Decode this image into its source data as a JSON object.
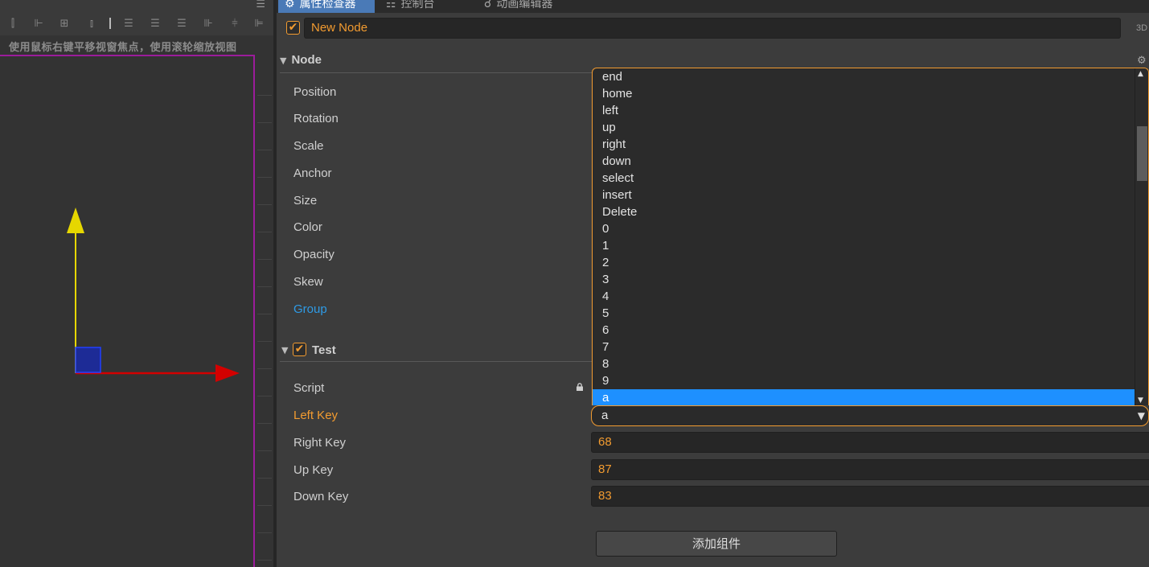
{
  "scene": {
    "hint": "使用鼠标右键平移视窗焦点，使用滚轮缩放视图",
    "toolbar_icons": [
      "align-left-icon",
      "align-hcenter-icon",
      "align-right-icon",
      "align-top-icon",
      "align-vcenter-icon",
      "align-bottom-icon",
      "distribute-h-icon",
      "distribute-v-icon",
      "distribute-center-icon"
    ],
    "menu_icon": "☰"
  },
  "tabs": [
    {
      "label": "属性检查器",
      "icon": "⚙",
      "active": true
    },
    {
      "label": "控制台",
      "icon": "☷",
      "active": false
    },
    {
      "label": "动画编辑器",
      "icon": "☌",
      "active": false
    }
  ],
  "node": {
    "name": "New Node",
    "active_check": "✔",
    "mode_label": "3D",
    "section_title": "Node",
    "section_arrow": "▼",
    "gear": "⚙",
    "props": [
      {
        "label": "Position"
      },
      {
        "label": "Rotation"
      },
      {
        "label": "Scale"
      },
      {
        "label": "Anchor"
      },
      {
        "label": "Size"
      },
      {
        "label": "Color"
      },
      {
        "label": "Opacity"
      },
      {
        "label": "Skew"
      },
      {
        "label": "Group"
      }
    ]
  },
  "test": {
    "section_title": "Test",
    "section_arrow": "▼",
    "check": "✔",
    "script_label": "Script",
    "left_key_label": "Left Key",
    "left_key_value": "a",
    "right_key_label": "Right Key",
    "right_key_value": "68",
    "up_key_label": "Up Key",
    "up_key_value": "87",
    "down_key_label": "Down Key",
    "down_key_value": "83",
    "select_arrow": "▼"
  },
  "dropdown": {
    "options": [
      "end",
      "home",
      "left",
      "up",
      "right",
      "down",
      "select",
      "insert",
      "Delete",
      "0",
      "1",
      "2",
      "3",
      "4",
      "5",
      "6",
      "7",
      "8",
      "9",
      "a"
    ],
    "selected": "a",
    "scroll_up": "▲",
    "scroll_down": "▼"
  },
  "add_component_label": "添加组件",
  "colors": {
    "accent_orange": "#f29b30",
    "selection_blue": "#1e90ff",
    "group_blue": "#2e9be6",
    "canvas_border": "#9b1c9b"
  }
}
